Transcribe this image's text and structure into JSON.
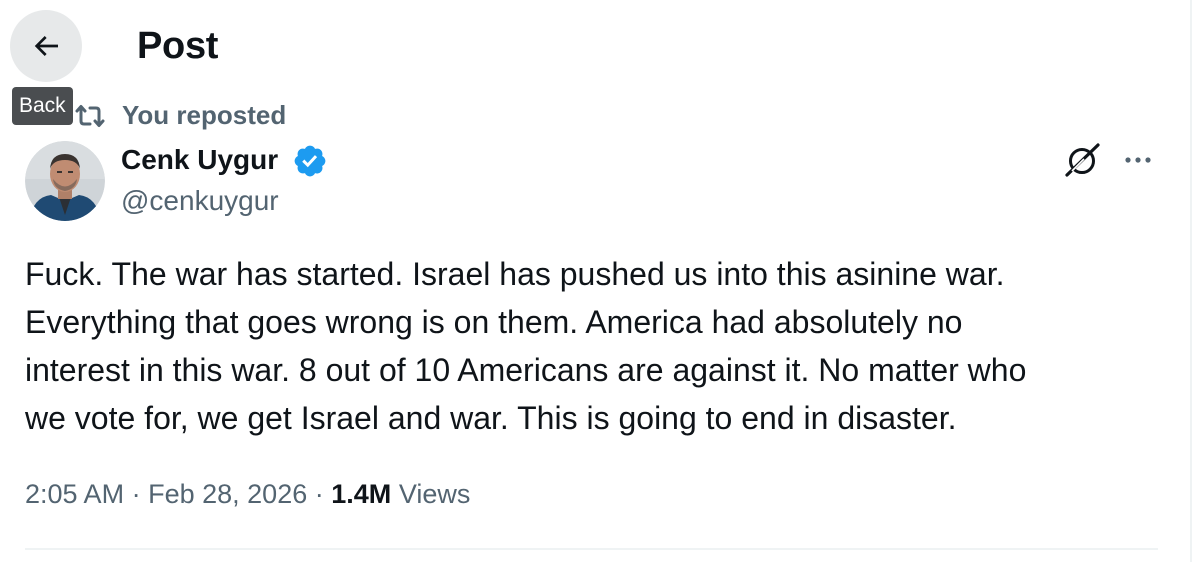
{
  "header": {
    "title": "Post",
    "back_icon": "arrow-left-icon",
    "back_tooltip": "Back"
  },
  "repost": {
    "icon": "repost-icon",
    "label": "You reposted"
  },
  "post": {
    "author": {
      "name": "Cenk Uygur",
      "handle": "@cenkuygur",
      "verified": true,
      "verified_color": "#1d9bf0"
    },
    "text_lines": [
      "Fuck. The war has started. Israel has pushed us into this asinine war.",
      "Everything that goes wrong is on them. America had absolutely no",
      "interest in this war. 8 out of 10 Americans are against it. No matter who",
      "we vote for, we get Israel and war. This is going to end in disaster."
    ],
    "time": "2:05 AM",
    "separator": "·",
    "date": "Feb 28, 2026",
    "views_count": "1.4M",
    "views_label": "Views",
    "actions": {
      "grok_icon": "grok-icon",
      "more_icon": "more-horizontal-icon"
    }
  },
  "colors": {
    "text_primary": "#0f1419",
    "text_secondary": "#536471",
    "accent": "#1d9bf0",
    "divider": "#eff3f4",
    "tooltip_bg": "#4a4d50",
    "back_button_hover": "#e7e9ea"
  }
}
